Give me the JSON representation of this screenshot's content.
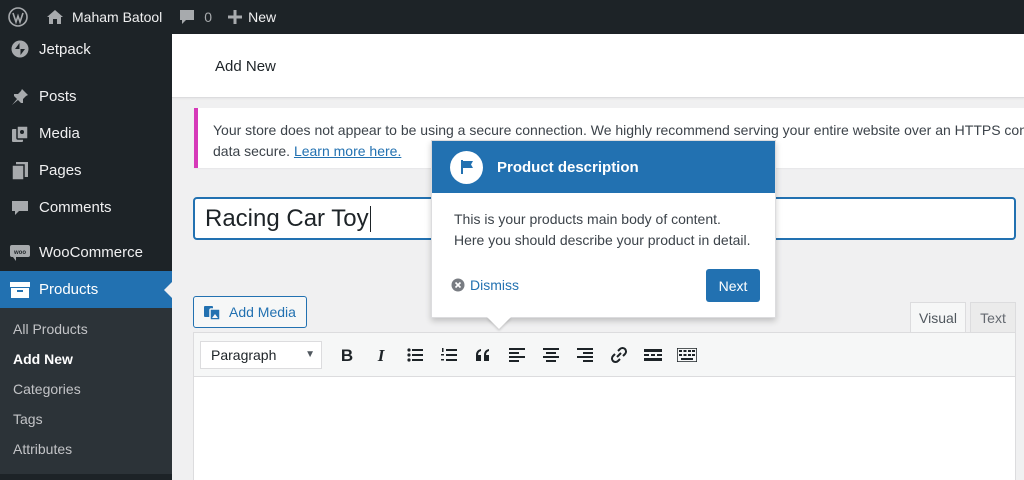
{
  "colors": {
    "admin_dark": "#1d2327",
    "accent": "#2271b1",
    "notice_border": "#d63ab9",
    "page_bg": "#f0f0f1"
  },
  "adminbar": {
    "logo_icon": "wordpress-logo-icon",
    "site_name": "Maham Batool",
    "comments_count": "0",
    "new_label": "New"
  },
  "sidebar": {
    "items": [
      {
        "label": "Jetpack",
        "icon": "jetpack-icon"
      },
      {
        "label": "Posts",
        "icon": "pin-icon"
      },
      {
        "label": "Media",
        "icon": "media-icon"
      },
      {
        "label": "Pages",
        "icon": "pages-icon"
      },
      {
        "label": "Comments",
        "icon": "comment-icon"
      },
      {
        "label": "WooCommerce",
        "icon": "woocommerce-icon"
      },
      {
        "label": "Products",
        "icon": "archive-icon"
      }
    ],
    "submenu": [
      "All Products",
      "Add New",
      "Categories",
      "Tags",
      "Attributes"
    ]
  },
  "header": {
    "title": "Add New"
  },
  "notice": {
    "text": "Your store does not appear to be using a secure connection. We highly recommend serving your entire website over an HTTPS conn",
    "text_line2": "data secure.",
    "link": "Learn more here."
  },
  "post": {
    "title_value": "Racing Car Toy"
  },
  "editor": {
    "add_media_label": "Add Media",
    "tab_visual": "Visual",
    "tab_text": "Text",
    "format_value": "Paragraph",
    "toolbar_icons": [
      "bold-icon",
      "italic-icon",
      "bulleted-list-icon",
      "numbered-list-icon",
      "blockquote-icon",
      "align-left-icon",
      "align-center-icon",
      "align-right-icon",
      "link-icon",
      "read-more-icon",
      "toolbar-toggle-icon"
    ]
  },
  "pointer": {
    "icon": "flag-icon",
    "title": "Product description",
    "body_line1": "This is your products main body of content.",
    "body_line2": "Here you should describe your product in detail.",
    "dismiss_label": "Dismiss",
    "next_label": "Next"
  }
}
